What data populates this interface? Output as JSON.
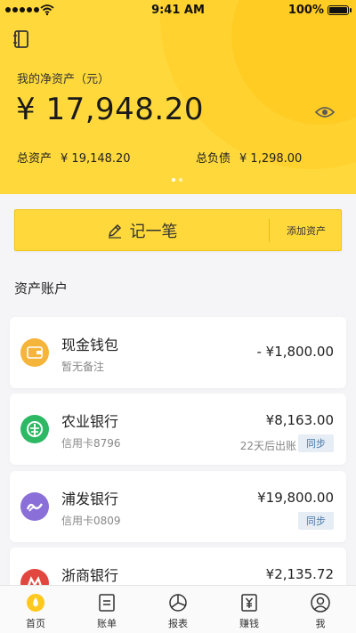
{
  "status_bar": {
    "time": "9:41 AM",
    "battery": "100%",
    "battery_level": 1.0
  },
  "header": {
    "net_worth_label": "我的净资产（元）",
    "net_worth": "¥ 17,948.20",
    "total_assets_label": "总资产",
    "total_assets": "¥ 19,148.20",
    "total_liabilities_label": "总负债",
    "total_liabilities": "¥ 1,298.00",
    "page_count": 2,
    "current_page": 1
  },
  "record_bar": {
    "record_label": "记一笔",
    "add_asset_label": "添加资产"
  },
  "section_title": "资产账户",
  "accounts": [
    {
      "name": "现金钱包",
      "sub": "暂无备注",
      "amount": "- ¥1,800.00",
      "icon": "wallet-icon",
      "icon_color": "#f5b43a"
    },
    {
      "name": "农业银行",
      "sub": "信用卡8796",
      "amount": "¥8,163.00",
      "due": "22天后出账",
      "sync": "同步",
      "icon": "abc-bank-icon",
      "icon_color": "#2db864"
    },
    {
      "name": "浦发银行",
      "sub": "信用卡0809",
      "amount": "¥19,800.00",
      "sync": "同步",
      "icon": "spdb-bank-icon",
      "icon_color": "#8a6fd8"
    },
    {
      "name": "浙商银行",
      "amount": "¥2,135.72",
      "icon": "czb-bank-icon",
      "icon_color": "#e2473f"
    }
  ],
  "tabs": [
    {
      "label": "首页",
      "icon": "home-icon",
      "active": true
    },
    {
      "label": "账单",
      "icon": "bill-icon"
    },
    {
      "label": "报表",
      "icon": "chart-icon"
    },
    {
      "label": "赚钱",
      "icon": "earn-icon"
    },
    {
      "label": "我",
      "icon": "profile-icon"
    }
  ],
  "colors": {
    "brand": "#ffd93b",
    "sync_bg": "#e6edf5",
    "sync_text": "#4a79a8"
  }
}
